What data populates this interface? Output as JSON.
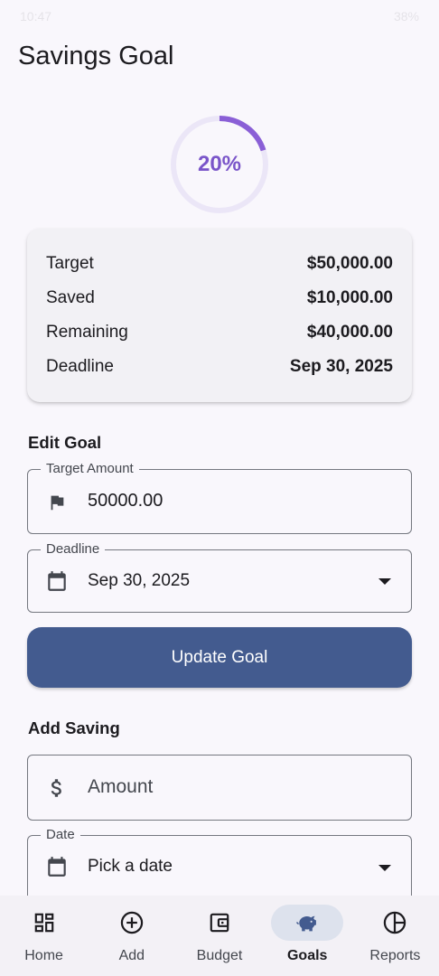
{
  "status_bar": {
    "time": "10:47",
    "battery": "38%"
  },
  "header": {
    "title": "Savings Goal"
  },
  "progress": {
    "label": "20%",
    "fraction": 0.2,
    "color": "#8a5fd6",
    "track_color": "#ebe6f7"
  },
  "summary": {
    "rows": [
      {
        "label": "Target",
        "value": "$50,000.00"
      },
      {
        "label": "Saved",
        "value": "$10,000.00"
      },
      {
        "label": "Remaining",
        "value": "$40,000.00"
      },
      {
        "label": "Deadline",
        "value": "Sep 30, 2025"
      }
    ]
  },
  "edit_goal": {
    "section_title": "Edit Goal",
    "target_field": {
      "legend": "Target Amount",
      "value": "50000.00",
      "icon": "flag-icon"
    },
    "deadline_field": {
      "legend": "Deadline",
      "value": "Sep 30, 2025",
      "icon": "calendar-icon"
    },
    "update_button": "Update Goal",
    "button_color": "#435b8f"
  },
  "add_saving": {
    "section_title": "Add Saving",
    "amount_field": {
      "placeholder": "Amount",
      "icon": "dollar-icon"
    },
    "date_field": {
      "legend": "Date",
      "placeholder": "Pick a date",
      "icon": "calendar-icon"
    }
  },
  "bottom_nav": {
    "items": [
      {
        "label": "Home",
        "icon": "dashboard-icon"
      },
      {
        "label": "Add",
        "icon": "add-circle-icon"
      },
      {
        "label": "Budget",
        "icon": "wallet-icon"
      },
      {
        "label": "Goals",
        "icon": "piggy-bank-icon",
        "active": true
      },
      {
        "label": "Reports",
        "icon": "pie-chart-icon"
      }
    ]
  }
}
